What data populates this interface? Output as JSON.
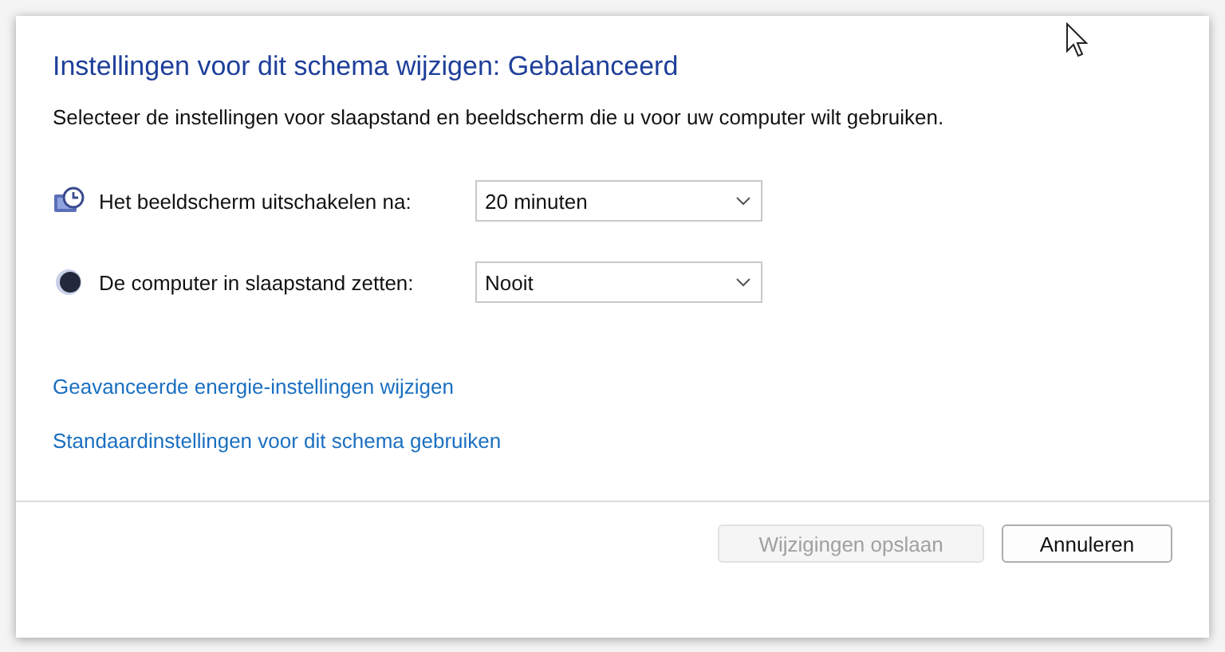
{
  "title": "Instellingen voor dit schema wijzigen: Gebalanceerd",
  "description": "Selecteer de instellingen voor slaapstand en beeldscherm die u voor uw computer wilt gebruiken.",
  "settings": [
    {
      "kind": "display",
      "label": "Het beeldscherm uitschakelen na:",
      "value": "20 minuten"
    },
    {
      "kind": "sleep",
      "label": "De computer in slaapstand zetten:",
      "value": "Nooit"
    }
  ],
  "links": [
    "Geavanceerde energie-instellingen wijzigen",
    "Standaardinstellingen voor dit schema gebruiken"
  ],
  "buttons": [
    {
      "label": "Wijzigingen opslaan",
      "disabled": true
    },
    {
      "label": "Annuleren",
      "disabled": false
    }
  ]
}
